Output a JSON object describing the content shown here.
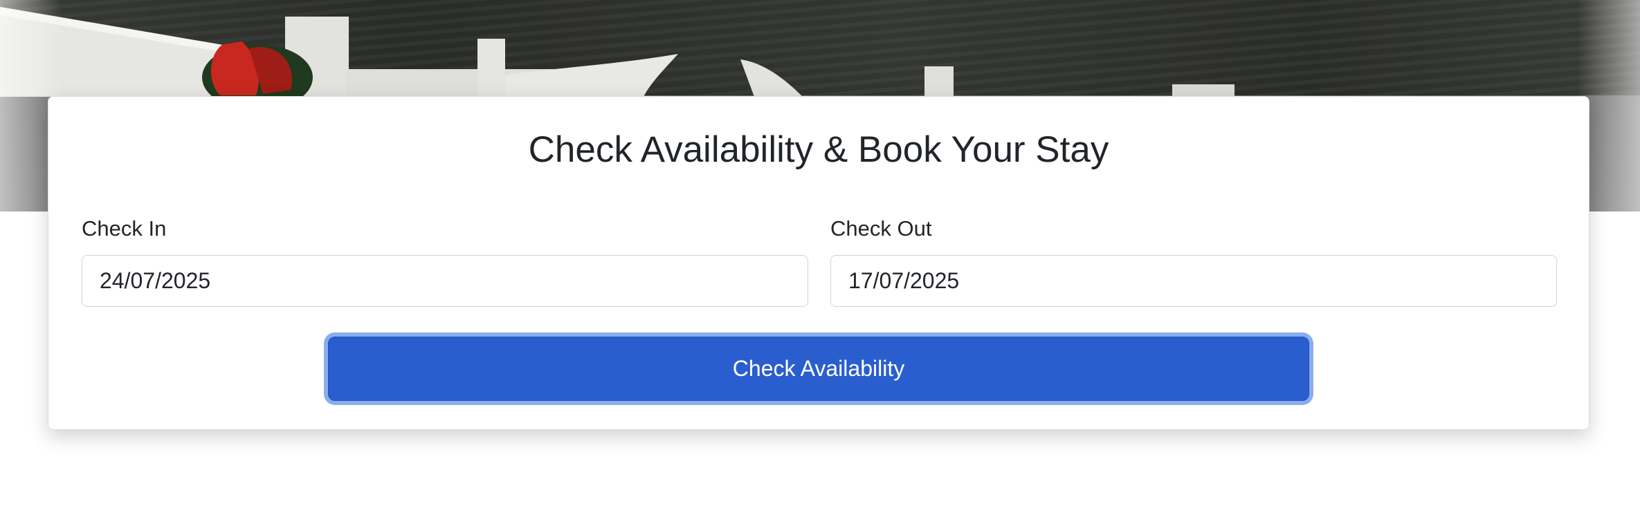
{
  "booking": {
    "title": "Check Availability & Book Your Stay",
    "check_in": {
      "label": "Check In",
      "value": "24/07/2025"
    },
    "check_out": {
      "label": "Check Out",
      "value": "17/07/2025"
    },
    "submit_label": "Check Availability"
  },
  "colors": {
    "primary_button": "#2a5ecf",
    "button_focus_ring": "#89aef0",
    "text": "#212529"
  }
}
